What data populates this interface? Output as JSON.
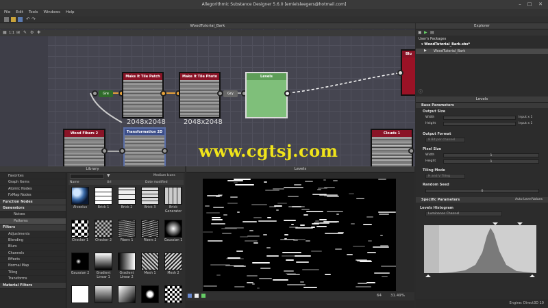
{
  "window": {
    "title": "Allegorithmic Substance Designer 5.6.0 [emielsleegers@hotmail.com]",
    "minimize": "–",
    "maximize": "□",
    "close": "✕"
  },
  "menu": [
    "File",
    "Edit",
    "Tools",
    "Windows",
    "Help"
  ],
  "graph": {
    "title": "WoodTutorial_Bark",
    "zoom": "1:1",
    "nodes": {
      "make_tile_patch": "Make It Tile Patch",
      "make_tile_photo": "Make It Tile Photo",
      "levels": "Levels",
      "wood_fibers": "Wood Fibers 2",
      "transformation": "Transformation 2D",
      "clouds": "Clouds 1",
      "blur": "Blu"
    },
    "pills": {
      "gre": "Gre",
      "gry": "Gry"
    },
    "size_labels": [
      "2048x2048",
      "2048x2048"
    ]
  },
  "watermark": "www.cgtsj.com",
  "library": {
    "title": "Library",
    "view_mode": "Medium Icons",
    "columns": [
      "Name",
      "Url",
      "Date modified"
    ],
    "tree": [
      {
        "label": "Favorites",
        "kind": "item"
      },
      {
        "label": "Graph Items",
        "kind": "item"
      },
      {
        "label": "Atomic Nodes",
        "kind": "item"
      },
      {
        "label": "FxMap Nodes",
        "kind": "item"
      },
      {
        "label": "Function Nodes",
        "kind": "sec"
      },
      {
        "label": "Generators",
        "kind": "sec"
      },
      {
        "label": "Noises",
        "kind": "sub"
      },
      {
        "label": "Patterns",
        "kind": "sub-sel"
      },
      {
        "label": "Filters",
        "kind": "sec"
      },
      {
        "label": "Adjustments",
        "kind": "item"
      },
      {
        "label": "Blending",
        "kind": "item"
      },
      {
        "label": "Blurs",
        "kind": "item"
      },
      {
        "label": "Channels",
        "kind": "item"
      },
      {
        "label": "Effects",
        "kind": "item"
      },
      {
        "label": "Normal Map",
        "kind": "item"
      },
      {
        "label": "Tiling",
        "kind": "item"
      },
      {
        "label": "Transforms",
        "kind": "item"
      },
      {
        "label": "Material Filters",
        "kind": "sec"
      }
    ],
    "thumbs": [
      {
        "label": "Alveolus",
        "style": "alveolus"
      },
      {
        "label": "Brick 1",
        "style": "brick"
      },
      {
        "label": "Brick 2",
        "style": "brick2"
      },
      {
        "label": "Brick 3",
        "style": "brick3"
      },
      {
        "label": "Brick Generator",
        "style": "brickgen"
      },
      {
        "label": "Checker 1",
        "style": "checker"
      },
      {
        "label": "Checker 2",
        "style": "checker2"
      },
      {
        "label": "Fibers 1",
        "style": "fibers"
      },
      {
        "label": "Fibers 2",
        "style": "fibers2"
      },
      {
        "label": "Gaussian 1",
        "style": "gauss"
      },
      {
        "label": "Gaussian 2",
        "style": "gauss2"
      },
      {
        "label": "Gradient Linear 1",
        "style": "grad1"
      },
      {
        "label": "Gradient Linear 2",
        "style": "grad2"
      },
      {
        "label": "Mesh 1",
        "style": "mesh"
      },
      {
        "label": "Mesh 2",
        "style": "mesh2"
      },
      {
        "label": "",
        "style": "s1"
      },
      {
        "label": "",
        "style": "s2"
      },
      {
        "label": "",
        "style": "s3"
      },
      {
        "label": "",
        "style": "s4"
      },
      {
        "label": "",
        "style": "s5"
      }
    ]
  },
  "viewer2d": {
    "title": "Levels",
    "zoom": "31.49%",
    "size": "64"
  },
  "explorer": {
    "title": "Explorer",
    "header": "User's Packages",
    "package": "WoodTutorial_Bark.sbs*",
    "graph_item": "WoodTutorial_Bark"
  },
  "properties": {
    "title": "Levels",
    "base_params": "Base Parameters",
    "output_size": "Output Size",
    "width": "Width",
    "height": "Height",
    "input_x1": "Input x 1",
    "output_format": "Output Format",
    "format_value": "8 Bit per channel",
    "pixel_size": "Pixel Size",
    "pixel_val": "1",
    "tiling_mode": "Tiling Mode",
    "tiling_value": "H and V Tiling",
    "random_seed": "Random Seed",
    "seed_value": "0",
    "specific_params": "Specific Parameters",
    "auto_level": "Auto Level",
    "values": "Values",
    "levels_histogram": "Levels Histogram",
    "channel": "Luminance Channel"
  },
  "status": "Engine: Direct3D 10"
}
